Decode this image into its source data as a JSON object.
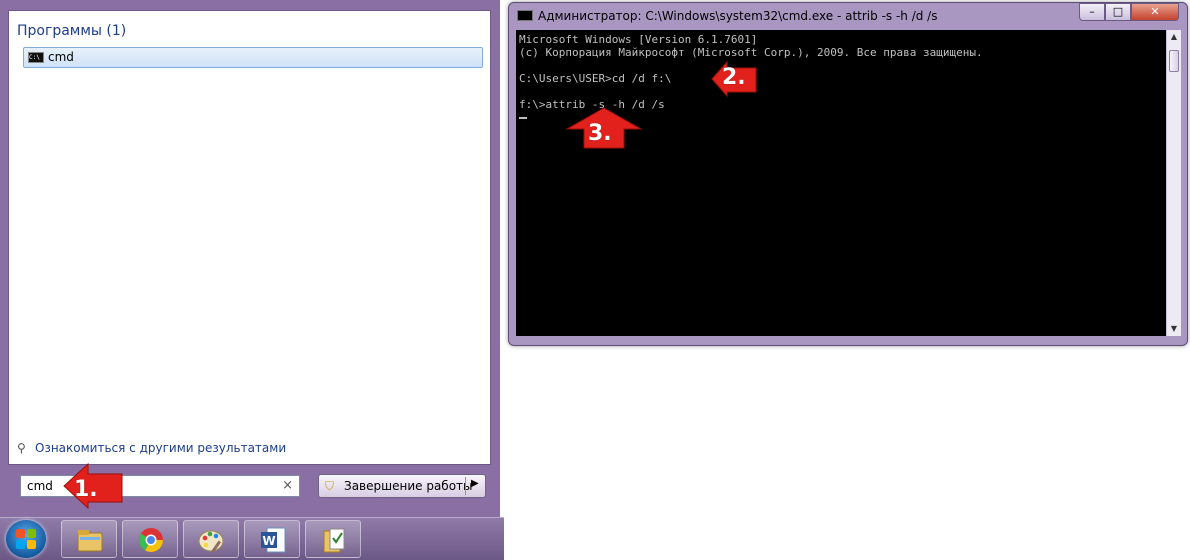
{
  "start_menu": {
    "section_header": "Программы (1)",
    "result_item": "cmd",
    "more_results": "Ознакомиться с другими результатами",
    "search_value": "cmd",
    "clear_symbol": "×",
    "shutdown_label": "Завершение работы",
    "shutdown_arrow": "▶"
  },
  "taskbar": {
    "start_icon": "windows-orb-icon",
    "items": [
      "explorer-icon",
      "chrome-icon",
      "paint-icon",
      "word-icon",
      "folder-icon"
    ]
  },
  "cmd_window": {
    "title": "Администратор: C:\\Windows\\system32\\cmd.exe - attrib  -s -h /d /s",
    "controls": {
      "minimize": "–",
      "maximize": "□",
      "close": "✕"
    },
    "lines": [
      "Microsoft Windows [Version 6.1.7601]",
      "(c) Корпорация Майкрософт (Microsoft Corp.), 2009. Все права защищены.",
      "",
      "C:\\Users\\USER>cd /d f:\\",
      "",
      "f:\\>attrib -s -h /d /s"
    ]
  },
  "annotations": [
    "1.",
    "2.",
    "3."
  ],
  "colors": {
    "annotation_red": "#e2211c",
    "console_bg": "#000000",
    "console_text": "#c0c0c0"
  }
}
